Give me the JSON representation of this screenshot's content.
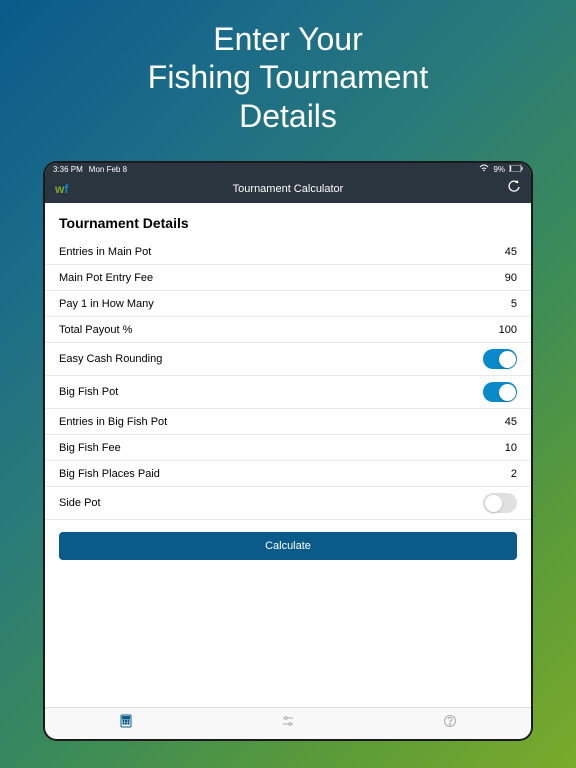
{
  "hero": {
    "line1": "Enter Your",
    "line2": "Fishing Tournament",
    "line3": "Details"
  },
  "statusBar": {
    "time": "3:36 PM",
    "date": "Mon Feb 8",
    "battery": "9%"
  },
  "navBar": {
    "title": "Tournament Calculator"
  },
  "section": {
    "title": "Tournament Details"
  },
  "rows": [
    {
      "label": "Entries in Main Pot",
      "value": "45",
      "type": "text"
    },
    {
      "label": "Main Pot Entry Fee",
      "value": "90",
      "type": "text"
    },
    {
      "label": "Pay 1 in How Many",
      "value": "5",
      "type": "text"
    },
    {
      "label": "Total Payout %",
      "value": "100",
      "type": "text"
    },
    {
      "label": "Easy Cash Rounding",
      "value": "on",
      "type": "toggle"
    },
    {
      "label": "Big Fish Pot",
      "value": "on",
      "type": "toggle"
    },
    {
      "label": "Entries in Big Fish Pot",
      "value": "45",
      "type": "text"
    },
    {
      "label": "Big Fish Fee",
      "value": "10",
      "type": "text"
    },
    {
      "label": "Big Fish Places Paid",
      "value": "2",
      "type": "text"
    },
    {
      "label": "Side Pot",
      "value": "off",
      "type": "toggle"
    }
  ],
  "button": {
    "calculate": "Calculate"
  }
}
